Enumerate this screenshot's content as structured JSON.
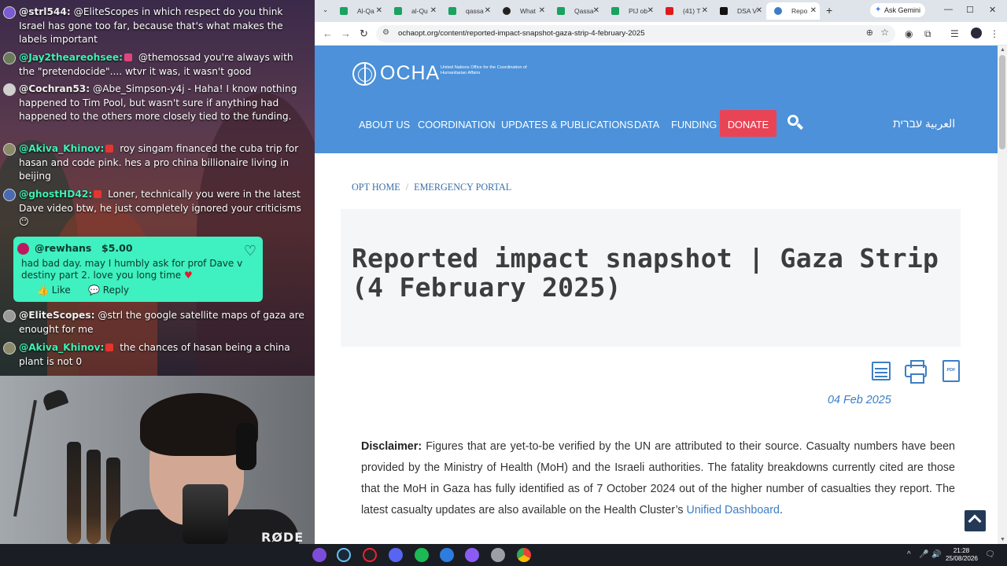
{
  "chat": {
    "messages": [
      {
        "user": "@strl544:",
        "text": "@EliteScopes in which respect do you think Israel has gone too far, because that's what makes the labels important"
      },
      {
        "user": "@Jay2theareohsee:",
        "text": "@themossad you're always with the \"pretendocide\".... wtvr it was, it wasn't good"
      },
      {
        "user": "@Cochran53:",
        "text": "@Abe_Simpson-y4j - Haha! I know nothing happened to Tim Pool, but wasn't sure if anything had happened to the others more closely tied to the funding."
      },
      {
        "user": "@Akiva_Khinov:",
        "text": "roy singam financed the cuba trip for hasan and code pink. hes a pro china billionaire living in beijing"
      },
      {
        "user": "@ghostHD42:",
        "text": "Loner, technically you were in the latest Dave video btw, he just completely ignored your criticisms"
      },
      {
        "user": "@EliteScopes:",
        "text": "@strl the google satellite maps of gaza are enought for me"
      },
      {
        "user": "@Akiva_Khinov:",
        "text": "the chances of hasan being a china plant is not 0"
      }
    ],
    "donation": {
      "user": "@rewhans",
      "amount": "$5.00",
      "text": "had bad day. may I humbly ask for prof Dave v destiny part 2. love you long time",
      "like_label": "Like",
      "reply_label": "Reply"
    }
  },
  "webcam": {
    "mic_brand": "RØDE"
  },
  "browser": {
    "tabs": [
      {
        "label": "Al-Qa",
        "color": "#1aa260"
      },
      {
        "label": "al-Qu",
        "color": "#1aa260"
      },
      {
        "label": "qassa",
        "color": "#1aa260"
      },
      {
        "label": "What",
        "color": "#222222"
      },
      {
        "label": "Qassa",
        "color": "#1aa260"
      },
      {
        "label": "PIJ ob",
        "color": "#1aa260"
      },
      {
        "label": "(41) T",
        "color": "#e01a1a"
      },
      {
        "label": "DSA V",
        "color": "#111111"
      },
      {
        "label": "Repo",
        "color": "#3c7ec4"
      }
    ],
    "ask_gemini": "Ask Gemini",
    "url": "ochaopt.org/content/reported-impact-snapshot-gaza-strip-4-february-2025"
  },
  "site": {
    "logo_word": "OCHA",
    "logo_sub": "United Nations Office for the Coordination of Humanitarian Affairs",
    "nav": [
      "ABOUT US",
      "COORDINATION",
      "UPDATES & PUBLICATIONS",
      "DATA",
      "FUNDING"
    ],
    "donate": "DONATE",
    "languages": "العربية  עברית",
    "breadcrumb": [
      "OPT HOME",
      "EMERGENCY PORTAL"
    ],
    "title": "Reported impact snapshot | Gaza Strip (4 February 2025)",
    "pdf_label": "PDF",
    "date": "04 Feb 2025",
    "disclaimer_label": "Disclaimer:",
    "disclaimer_text": " Figures that are yet-to-be verified by the UN are attributed to their source. Casualty numbers have been provided by the Ministry of Health (MoH) and the Israeli authorities. The fatality breakdowns currently cited are those that the MoH in Gaza has fully identified as of 7 October 2024 out of the higher number of casualties they report. The latest casualty updates are also available on the Health Cluster’s ",
    "disclaimer_link": "Unified Dashboard",
    "disclaimer_end": "."
  },
  "taskbar": {
    "time": "21:28",
    "date": "25/08/2026"
  }
}
